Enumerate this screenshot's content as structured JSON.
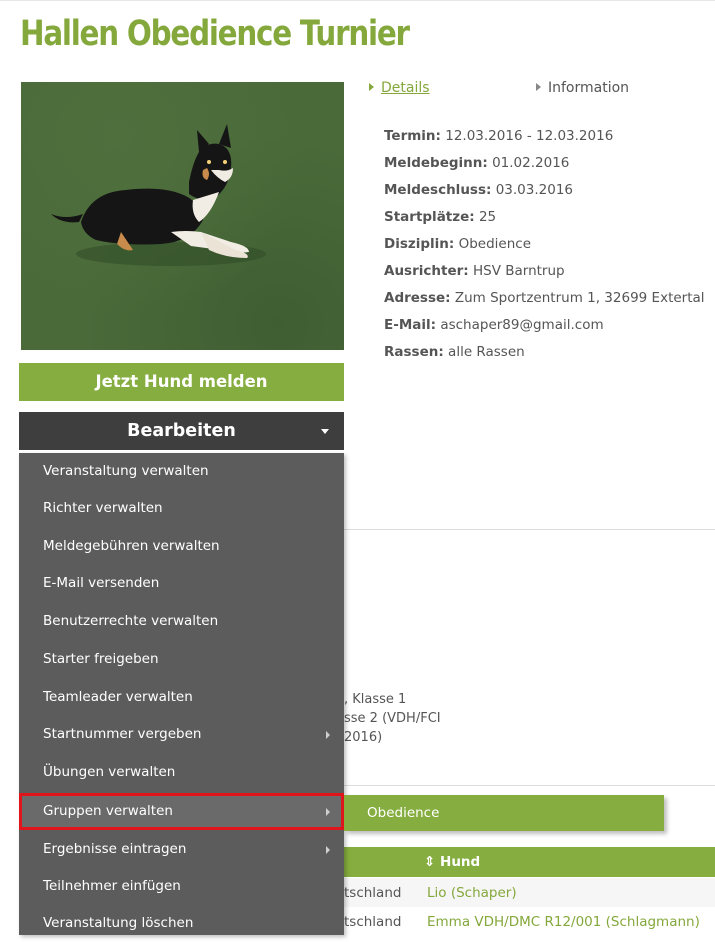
{
  "page": {
    "title": "Hallen Obedience Turnier"
  },
  "actions": {
    "register_label": "Jetzt Hund melden",
    "edit_label": "Bearbeiten"
  },
  "tabs": [
    {
      "label": "Details"
    },
    {
      "label": "Information"
    }
  ],
  "details": [
    {
      "label": "Termin:",
      "value": "12.03.2016 - 12.03.2016"
    },
    {
      "label": "Meldebeginn:",
      "value": "01.02.2016"
    },
    {
      "label": "Meldeschluss:",
      "value": "03.03.2016"
    },
    {
      "label": "Startplätze:",
      "value": "25"
    },
    {
      "label": "Disziplin:",
      "value": "Obedience"
    },
    {
      "label": "Ausrichter:",
      "value": "HSV Barntrup"
    },
    {
      "label": "Adresse:",
      "value": "Zum Sportzentrum 1, 32699 Extertal"
    },
    {
      "label": "E-Mail:",
      "value": "aschaper89@gmail.com"
    },
    {
      "label": "Rassen:",
      "value": "alle Rassen"
    }
  ],
  "menu": {
    "items": [
      {
        "label": "Veranstaltung verwalten",
        "submenu": false
      },
      {
        "label": "Richter verwalten",
        "submenu": false
      },
      {
        "label": "Meldegebühren verwalten",
        "submenu": false
      },
      {
        "label": "E-Mail versenden",
        "submenu": false
      },
      {
        "label": "Benutzerrechte verwalten",
        "submenu": false
      },
      {
        "label": "Starter freigeben",
        "submenu": false
      },
      {
        "label": "Teamleader verwalten",
        "submenu": false
      },
      {
        "label": "Startnummer vergeben",
        "submenu": true
      },
      {
        "label": "Übungen verwalten",
        "submenu": false
      },
      {
        "label": "Gruppen verwalten",
        "submenu": true,
        "highlighted": true
      },
      {
        "label": "Ergebnisse eintragen",
        "submenu": true
      },
      {
        "label": "Teilnehmer einfügen",
        "submenu": false
      },
      {
        "label": "Veranstaltung löschen",
        "submenu": false
      }
    ],
    "submenu_items": [
      {
        "label": "Obedience"
      }
    ]
  },
  "background_text": {
    "line1": ", Klasse 1",
    "line2": "sse 2 (VDH/FCI",
    "line3": "2016)"
  },
  "table": {
    "sort_icon": "sort-icon",
    "header_hund": "Hund",
    "rows": [
      {
        "land": "tschland",
        "hund": "Lio (Schaper)"
      },
      {
        "land": "tschland",
        "hund": "Emma VDH/DMC R12/001 (Schlagmann)"
      }
    ]
  },
  "colors": {
    "brand_green": "#86ad3f",
    "title_green": "#84a83b",
    "menu_bg": "#5c5c5c",
    "dark_button": "#3e3e3e",
    "highlight_outline": "#e0151c"
  }
}
